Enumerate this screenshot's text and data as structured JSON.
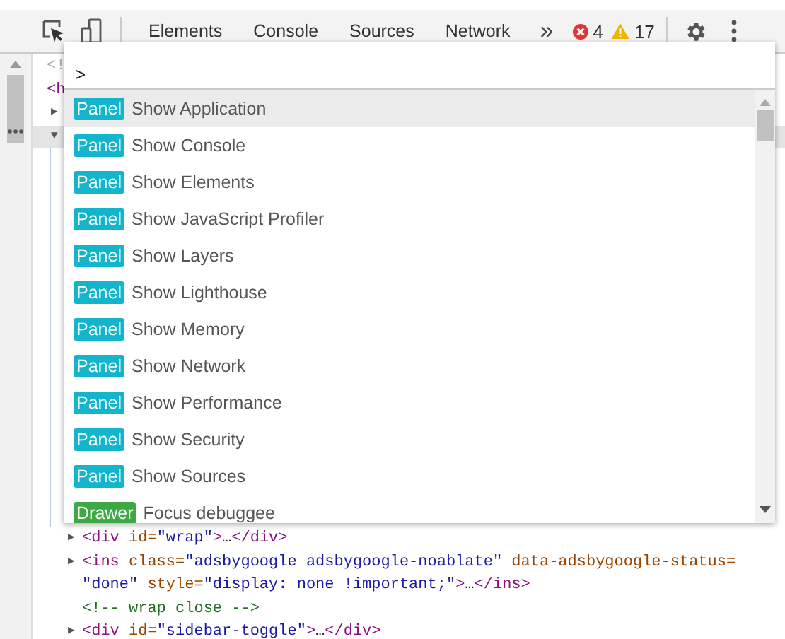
{
  "toolbar": {
    "tabs": [
      {
        "label": "Elements"
      },
      {
        "label": "Console"
      },
      {
        "label": "Sources"
      },
      {
        "label": "Network"
      }
    ],
    "more": "»",
    "errors": "4",
    "warnings": "17"
  },
  "dom_tree": {
    "top_lines": [
      {
        "selected": false,
        "tokens": [
          {
            "kind": "faded",
            "text": "<!"
          }
        ]
      },
      {
        "selected": false,
        "tokens": [
          {
            "kind": "tag",
            "text": "<h"
          }
        ]
      },
      {
        "expander": "▶",
        "selected": false
      },
      {
        "expander": "▼",
        "selected": true
      }
    ],
    "bottom_lines": [
      {
        "expander": "▶",
        "tokens": [
          {
            "kind": "tag",
            "text": "<div"
          },
          {
            "kind": "attr",
            "text": " id="
          },
          {
            "kind": "value",
            "text": "\"wrap\""
          },
          {
            "kind": "tag",
            "text": ">"
          },
          {
            "kind": "text",
            "text": "…"
          },
          {
            "kind": "tag",
            "text": "</div>"
          }
        ]
      },
      {
        "expander": "▶",
        "tokens": [
          {
            "kind": "tag",
            "text": "<ins"
          },
          {
            "kind": "attr",
            "text": " class="
          },
          {
            "kind": "value",
            "text": "\"adsbygoogle adsbygoogle-noablate\""
          },
          {
            "kind": "attr",
            "text": " data-adsbygoogle-status="
          },
          {
            "kind": "value",
            "text": "\"done\""
          },
          {
            "kind": "attr",
            "text": " style="
          },
          {
            "kind": "value",
            "text": "\"display: none !important;\""
          },
          {
            "kind": "tag",
            "text": ">"
          },
          {
            "kind": "text",
            "text": "…"
          },
          {
            "kind": "tag",
            "text": "</ins>"
          }
        ]
      },
      {
        "tokens": [
          {
            "kind": "comment",
            "text": "<!-- wrap close -->"
          }
        ]
      },
      {
        "expander": "▶",
        "tokens": [
          {
            "kind": "tag",
            "text": "<div"
          },
          {
            "kind": "attr",
            "text": " id="
          },
          {
            "kind": "value",
            "text": "\"sidebar-toggle\""
          },
          {
            "kind": "tag",
            "text": ">"
          },
          {
            "kind": "text",
            "text": "…"
          },
          {
            "kind": "tag",
            "text": "</div>"
          }
        ]
      }
    ]
  },
  "command_menu": {
    "value": ">",
    "items": [
      {
        "kind": "panel",
        "category": "Panel",
        "label": "Show Application",
        "selected": true
      },
      {
        "kind": "panel",
        "category": "Panel",
        "label": "Show Console",
        "selected": false
      },
      {
        "kind": "panel",
        "category": "Panel",
        "label": "Show Elements",
        "selected": false
      },
      {
        "kind": "panel",
        "category": "Panel",
        "label": "Show JavaScript Profiler",
        "selected": false
      },
      {
        "kind": "panel",
        "category": "Panel",
        "label": "Show Layers",
        "selected": false
      },
      {
        "kind": "panel",
        "category": "Panel",
        "label": "Show Lighthouse",
        "selected": false
      },
      {
        "kind": "panel",
        "category": "Panel",
        "label": "Show Memory",
        "selected": false
      },
      {
        "kind": "panel",
        "category": "Panel",
        "label": "Show Network",
        "selected": false
      },
      {
        "kind": "panel",
        "category": "Panel",
        "label": "Show Performance",
        "selected": false
      },
      {
        "kind": "panel",
        "category": "Panel",
        "label": "Show Security",
        "selected": false
      },
      {
        "kind": "panel",
        "category": "Panel",
        "label": "Show Sources",
        "selected": false
      },
      {
        "kind": "drawer",
        "category": "Drawer",
        "label": "Focus debuggee",
        "selected": false
      }
    ]
  }
}
